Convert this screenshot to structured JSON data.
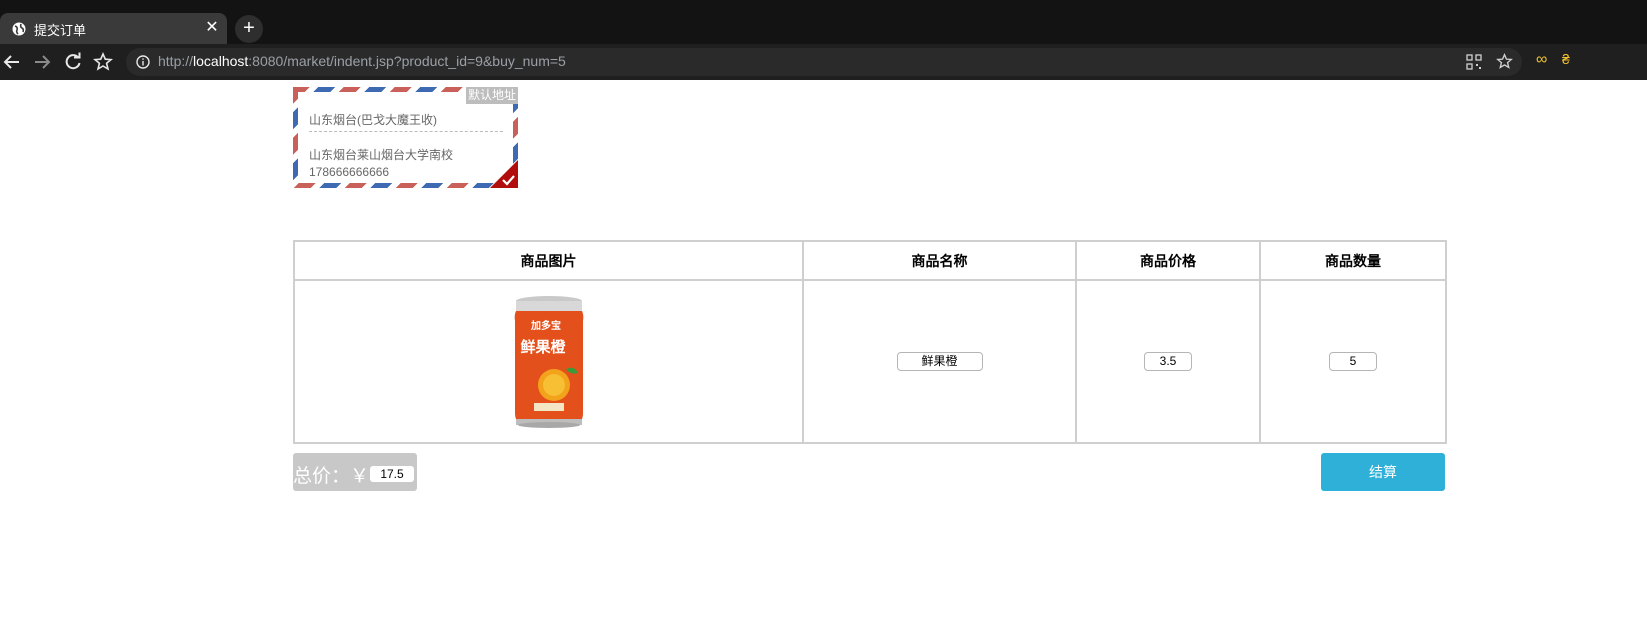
{
  "browser": {
    "tab_title": "提交订单",
    "tab_close": "✕",
    "new_tab": "+",
    "url_prefix": "http://",
    "url_host": "localhost",
    "url_rest": ":8080/market/indent.jsp?product_id=9&buy_num=5"
  },
  "address": {
    "badge": "默认地址",
    "recipient": "山东烟台(巴戈大魔王收)",
    "street": "山东烟台莱山烟台大学南校",
    "phone": "178666666666"
  },
  "table": {
    "headers": [
      "商品图片",
      "商品名称",
      "商品价格",
      "商品数量"
    ],
    "row": {
      "product_name": "鲜果橙",
      "price": "3.5",
      "quantity": "5"
    }
  },
  "product_can": {
    "brand": "加多宝",
    "title": "鲜果橙"
  },
  "total": {
    "label": "总价：￥",
    "value": "17.5"
  },
  "checkout_label": "结算",
  "colors": {
    "accent": "#2eb0d8",
    "airmail_red": "#c9605a",
    "airmail_blue": "#3e69b3",
    "check_red": "#b10d0d",
    "can_orange": "#e4501c"
  }
}
